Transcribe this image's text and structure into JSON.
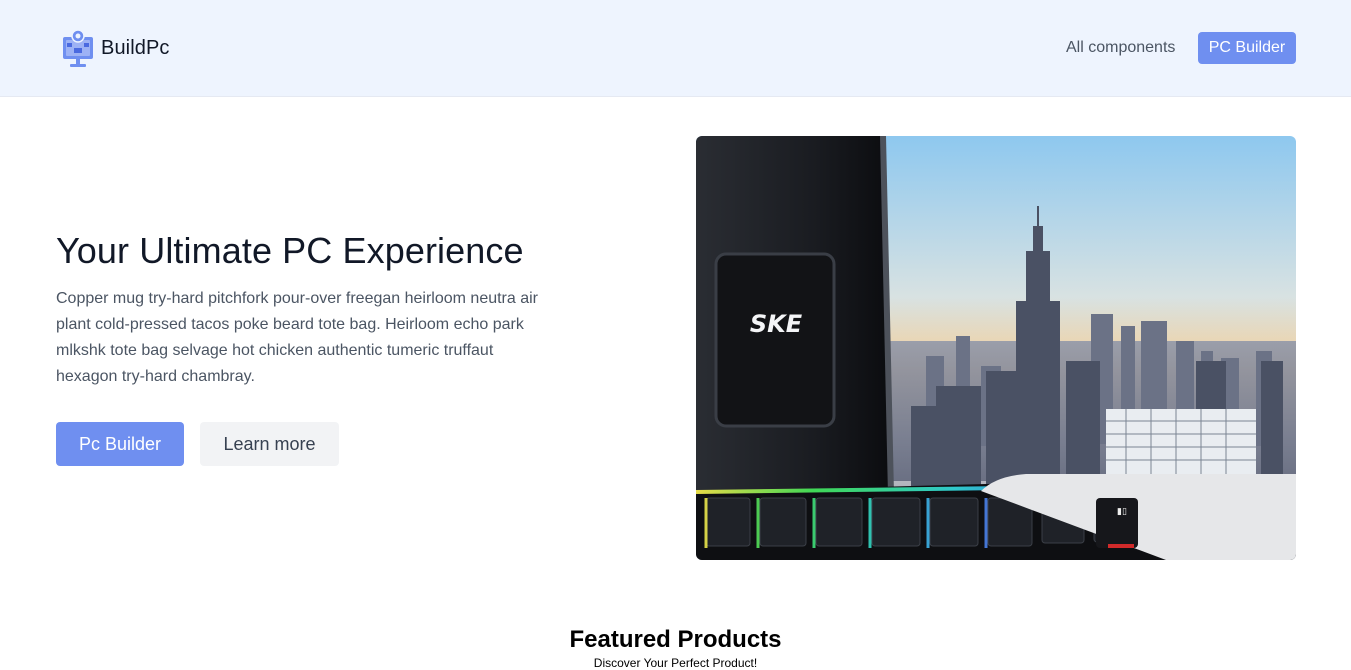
{
  "brand": {
    "name": "BuildPc",
    "logo_icon": "pc-builder-logo-icon"
  },
  "nav": {
    "all_components": "All components",
    "pc_builder": "PC Builder"
  },
  "hero": {
    "title": "Your Ultimate PC Experience",
    "description": "Copper mug try-hard pitchfork pour-over freegan heirloom neutra air plant cold-pressed tacos poke beard tote bag. Heirloom echo park mlkshk tote bag selvage hot chicken authentic tumeric truffaut hexagon try-hard chambray.",
    "primary_button": "Pc Builder",
    "secondary_button": "Learn more",
    "image_badge_text": "SKE"
  },
  "featured": {
    "title": "Featured Products",
    "subtitle": "Discover Your Perfect Product!"
  },
  "colors": {
    "accent": "#6f8ff0",
    "navbar_bg": "#eef4fe",
    "heading": "#111827",
    "body_text": "#4b5563",
    "secondary_button_bg": "#f2f3f5"
  }
}
